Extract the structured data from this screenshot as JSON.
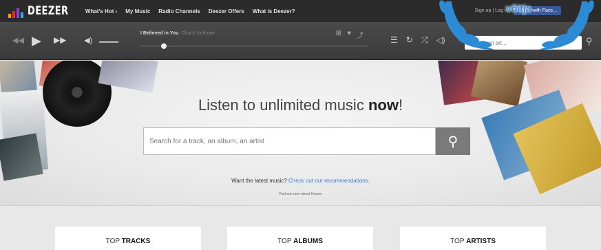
{
  "nav": {
    "logo": "DEEZER",
    "links": [
      "What's Hot ›",
      "My Music",
      "Radio Channels",
      "Deezer Offers",
      "What is Deezer?"
    ],
    "signin": "Sign up | Log in",
    "connect": "Log in with Face..."
  },
  "player": {
    "track_title": "I Believed in You",
    "track_artist": "Chuck Inchoate",
    "search_placeholder": "Search an art..."
  },
  "badge": {
    "text": "võitja"
  },
  "hero": {
    "title_prefix": "Listen to unlimited music ",
    "title_bold": "now",
    "title_suffix": "!",
    "search_placeholder": "Search for a track, an album, an artist",
    "latest_prefix": "Want the latest music? ",
    "latest_link": "Check out our recommendations.",
    "find_out": "Find out more about Deezer"
  },
  "cards": [
    {
      "prefix": "TOP ",
      "bold": "TRACKS"
    },
    {
      "prefix": "TOP ",
      "bold": "ALBUMS"
    },
    {
      "prefix": "TOP ",
      "bold": "ARTISTS"
    }
  ],
  "colors": {
    "nav_bg": "#2b2b2b",
    "player_bg": "#404040",
    "accent_link": "#3f7fc4",
    "badge": "#2d8bd6",
    "connect": "#3b5998"
  }
}
